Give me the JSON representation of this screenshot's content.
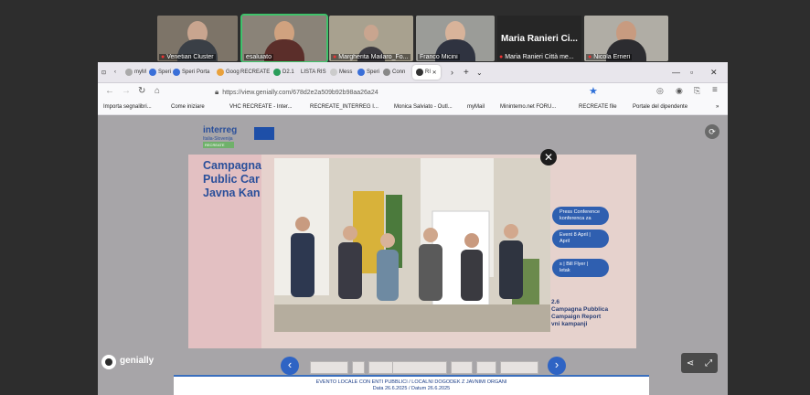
{
  "participants": [
    {
      "name": "Venetian Cluster",
      "active": false
    },
    {
      "name": "esaluiato",
      "active": true
    },
    {
      "name": "Margherita Mailaro_Fo...",
      "active": false
    },
    {
      "name": "Franco Micini",
      "active": false
    },
    {
      "name": "Maria Ranieri Città me...",
      "active": false
    },
    {
      "name": "Nicola Errieri",
      "active": false
    }
  ],
  "name_card": {
    "big": "Maria Ranieri Ci...",
    "label": "Maria Ranieri Città me..."
  },
  "browser": {
    "tabs": [
      "myM",
      "Speri",
      "Speri",
      "Porta",
      "Goog",
      "RECREATE",
      "D2.1",
      "LISTA RIS",
      "Mess",
      "Speri",
      "Conn",
      "RI"
    ],
    "url": "https://view.genially.com/678d2e2a509b92b98aa26a24",
    "bookmarks": [
      "Importa segnalibri...",
      "Come iniziare",
      "VHC RECREATE - Inter...",
      "RECREATE_INTERREG I...",
      "Monica Salviato - Outl...",
      "myMail",
      "Minintemo.net FORU...",
      "RECREATE file",
      "Portale del dipendente"
    ]
  },
  "slide": {
    "program": "interreg",
    "program_sub": "Italia-Slovenija",
    "project_tag": "RECREATE",
    "campaign_lines": [
      "Campagna",
      "Public Car",
      "Javna Kan"
    ],
    "pills": [
      "Press Conference\nkonferenca za",
      "Event 8 April |\nApril",
      "s | Bill Flyer |\nletak"
    ],
    "side_text": "2.6\nCampagna Pubblica\nCampaign Report\nvni kampanji"
  },
  "genially": {
    "label": "genially"
  },
  "footer": {
    "line1": "EVENTO LOCALE CON ENTI PUBBLICI / LOCALNI DOGODEK Z JAVNIMI ORGANI",
    "line2": "Data 26.6.2025 / Datum 26.6.2025"
  },
  "colors": {
    "accent": "#2f64c4",
    "brand": "#2a4f9a",
    "active_tile": "#3fc26b"
  },
  "icons": [
    "close-icon",
    "chevron-left-icon",
    "chevron-right-icon",
    "share-icon",
    "fullscreen-icon",
    "reload-icon",
    "star-icon",
    "mic-muted-icon"
  ]
}
